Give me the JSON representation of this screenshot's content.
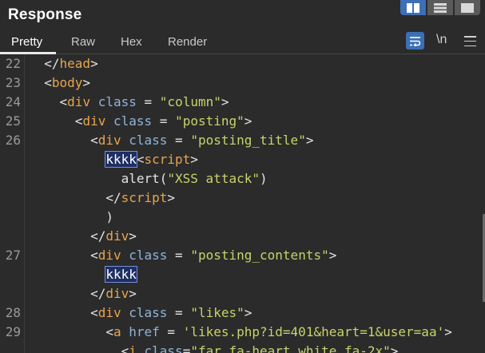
{
  "header": {
    "title": "Response",
    "layout_buttons": [
      "split-vertical",
      "split-horizontal",
      "single-pane"
    ]
  },
  "tabs": [
    {
      "label": "Pretty",
      "active": true
    },
    {
      "label": "Raw",
      "active": false
    },
    {
      "label": "Hex",
      "active": false
    },
    {
      "label": "Render",
      "active": false
    }
  ],
  "toolbar": {
    "wrap_icon": "word-wrap-icon",
    "newline_label": "\\n",
    "menu_icon": "hamburger-menu-icon"
  },
  "colors": {
    "background": "#2b2b2b",
    "accent": "#3d6fb6",
    "tag": "#e7a54e",
    "attribute": "#8fb4d9",
    "string": "#c8d36a",
    "highlight_bg": "#1e2f63"
  },
  "code": {
    "line_numbers": [
      "22",
      "23",
      "24",
      "25",
      "26",
      "27",
      "28",
      "29"
    ],
    "lines": [
      {
        "num": "22",
        "indent": "  ",
        "parts": [
          [
            "plain",
            "</"
          ],
          [
            "tag",
            "head"
          ],
          [
            "plain",
            ">"
          ]
        ]
      },
      {
        "num": "23",
        "indent": "  ",
        "parts": [
          [
            "plain",
            "<"
          ],
          [
            "tag",
            "body"
          ],
          [
            "plain",
            ">"
          ]
        ]
      },
      {
        "num": "24",
        "indent": "    ",
        "parts": [
          [
            "plain",
            "<"
          ],
          [
            "tag",
            "div"
          ],
          [
            "plain",
            " "
          ],
          [
            "attr",
            "class"
          ],
          [
            "plain",
            " = "
          ],
          [
            "str",
            "\"column\""
          ],
          [
            "plain",
            ">"
          ]
        ]
      },
      {
        "num": "25",
        "indent": "      ",
        "parts": [
          [
            "plain",
            "<"
          ],
          [
            "tag",
            "div"
          ],
          [
            "plain",
            " "
          ],
          [
            "attr",
            "class"
          ],
          [
            "plain",
            " = "
          ],
          [
            "str",
            "\"posting\""
          ],
          [
            "plain",
            ">"
          ]
        ]
      },
      {
        "num": "26",
        "indent": "        ",
        "parts": [
          [
            "plain",
            "<"
          ],
          [
            "tag",
            "div"
          ],
          [
            "plain",
            " "
          ],
          [
            "attr",
            "class"
          ],
          [
            "plain",
            " = "
          ],
          [
            "str",
            "\"posting_title\""
          ],
          [
            "plain",
            ">"
          ]
        ]
      },
      {
        "num": "",
        "indent": "          ",
        "parts": [
          [
            "hl",
            "kkkk"
          ],
          [
            "plain",
            "<"
          ],
          [
            "tag",
            "script"
          ],
          [
            "plain",
            ">"
          ]
        ]
      },
      {
        "num": "",
        "indent": "            ",
        "parts": [
          [
            "plain",
            "alert("
          ],
          [
            "str",
            "\"XSS attack\""
          ],
          [
            "plain",
            ")"
          ]
        ]
      },
      {
        "num": "",
        "indent": "          ",
        "parts": [
          [
            "plain",
            "</"
          ],
          [
            "tag",
            "script"
          ],
          [
            "plain",
            ">"
          ]
        ]
      },
      {
        "num": "",
        "indent": "          ",
        "parts": [
          [
            "plain",
            ")"
          ]
        ]
      },
      {
        "num": "",
        "indent": "        ",
        "parts": [
          [
            "plain",
            "</"
          ],
          [
            "tag",
            "div"
          ],
          [
            "plain",
            ">"
          ]
        ]
      },
      {
        "num": "27",
        "indent": "        ",
        "parts": [
          [
            "plain",
            "<"
          ],
          [
            "tag",
            "div"
          ],
          [
            "plain",
            " "
          ],
          [
            "attr",
            "class"
          ],
          [
            "plain",
            " = "
          ],
          [
            "str",
            "\"posting_contents\""
          ],
          [
            "plain",
            ">"
          ]
        ]
      },
      {
        "num": "",
        "indent": "          ",
        "parts": [
          [
            "hl",
            "kkkk"
          ]
        ]
      },
      {
        "num": "",
        "indent": "        ",
        "parts": [
          [
            "plain",
            "</"
          ],
          [
            "tag",
            "div"
          ],
          [
            "plain",
            ">"
          ]
        ]
      },
      {
        "num": "28",
        "indent": "        ",
        "parts": [
          [
            "plain",
            "<"
          ],
          [
            "tag",
            "div"
          ],
          [
            "plain",
            " "
          ],
          [
            "attr",
            "class"
          ],
          [
            "plain",
            " = "
          ],
          [
            "str",
            "\"likes\""
          ],
          [
            "plain",
            ">"
          ]
        ]
      },
      {
        "num": "29",
        "indent": "          ",
        "parts": [
          [
            "plain",
            "<"
          ],
          [
            "tag",
            "a"
          ],
          [
            "plain",
            " "
          ],
          [
            "attr",
            "href"
          ],
          [
            "plain",
            " = "
          ],
          [
            "str",
            "'likes.php?id=401&heart=1&user=aa'"
          ],
          [
            "plain",
            ">"
          ]
        ]
      },
      {
        "num": "",
        "indent": "            ",
        "parts": [
          [
            "plain",
            "<"
          ],
          [
            "tag",
            "i"
          ],
          [
            "plain",
            " "
          ],
          [
            "attr",
            "class"
          ],
          [
            "plain",
            "="
          ],
          [
            "str",
            "\"far fa-heart white fa-2x\""
          ],
          [
            "plain",
            ">"
          ]
        ]
      }
    ]
  }
}
